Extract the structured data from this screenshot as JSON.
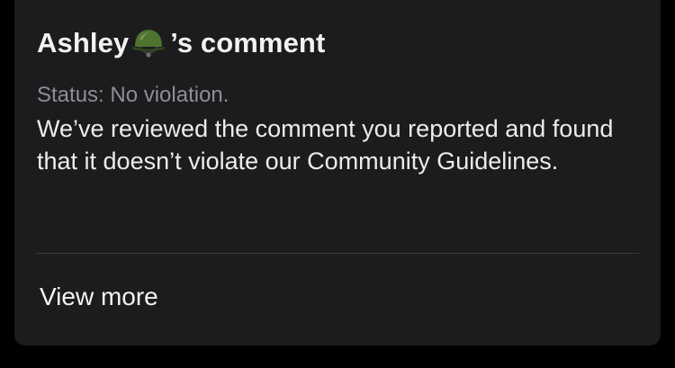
{
  "report": {
    "author_name": "Ashley",
    "author_emoji_icon": "military-helmet-icon",
    "title_suffix": "’s comment",
    "status": "Status: No violation.",
    "message": "We’ve reviewed the comment you reported and found that it doesn’t violate our Community Guidelines.",
    "view_more_label": "View more"
  },
  "colors": {
    "background": "#000000",
    "card": "#1c1c1e",
    "primary_text": "#f2f2f2",
    "secondary_text": "#8e8e93",
    "divider": "#3a3a3c",
    "helmet": "#4a6b2c"
  }
}
